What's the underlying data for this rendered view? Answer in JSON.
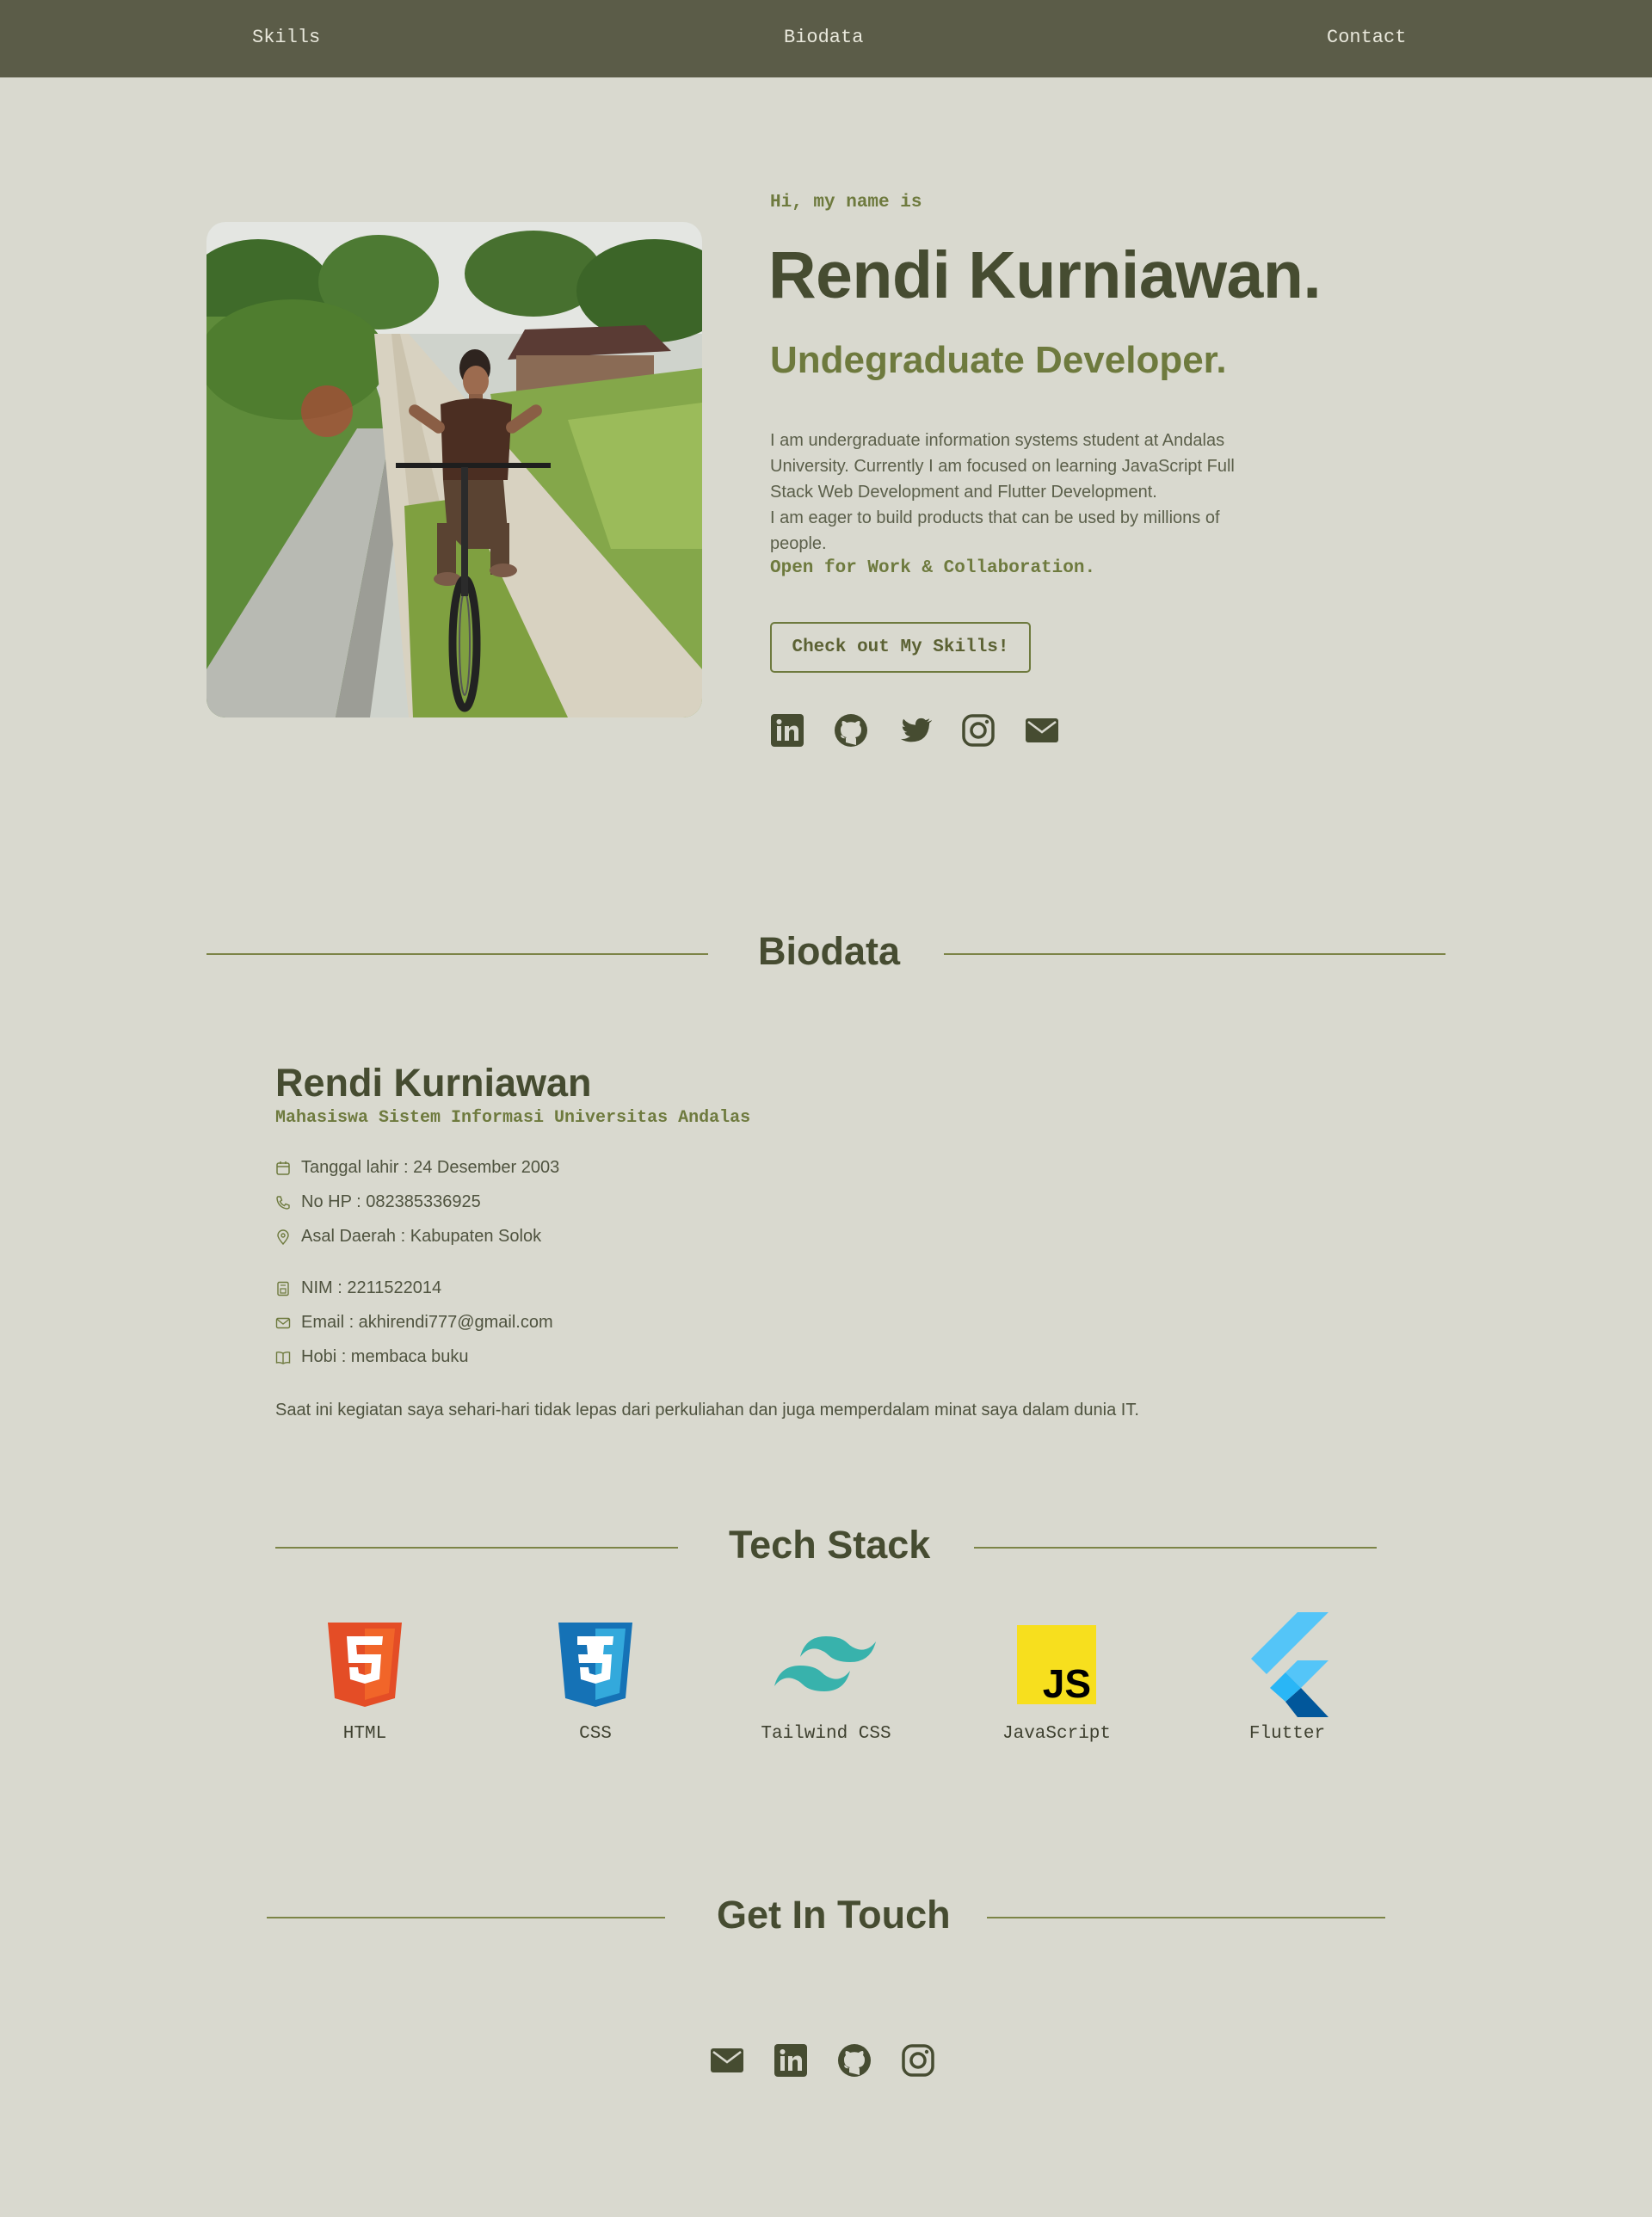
{
  "nav": {
    "items": [
      "Skills",
      "Biodata",
      "Contact"
    ]
  },
  "hero": {
    "greeting": "Hi, my name is",
    "name": "Rendi Kurniawan.",
    "role": "Undegraduate Developer.",
    "description": "I am undergraduate information systems student at Andalas University. Currently I am focused on learning JavaScript Full Stack Web Development and Flutter Development.",
    "description2": "I am eager to build products that can be used by millions of people.",
    "open_text": "Open for Work & Collaboration.",
    "cta_label": "Check out My Skills!",
    "socials": [
      "linkedin-icon",
      "github-icon",
      "twitter-icon",
      "instagram-icon",
      "mail-icon"
    ]
  },
  "biodata": {
    "heading": "Biodata",
    "name": "Rendi Kurniawan",
    "subtitle": "Mahasiswa Sistem Informasi Universitas Andalas",
    "items": [
      {
        "icon": "calendar-icon",
        "text": "Tanggal lahir : 24 Desember 2003"
      },
      {
        "icon": "phone-icon",
        "text": "No HP : 082385336925"
      },
      {
        "icon": "location-pin-icon",
        "text": "Asal Daerah : Kabupaten Solok"
      },
      {
        "icon": "id-card-icon",
        "text": "NIM : 2211522014"
      },
      {
        "icon": "envelope-icon",
        "text": "Email : akhirendi777@gmail.com"
      },
      {
        "icon": "book-icon",
        "text": "Hobi : membaca buku"
      }
    ],
    "paragraph": "Saat ini kegiatan saya sehari-hari tidak lepas dari perkuliahan dan juga memperdalam minat saya dalam dunia IT."
  },
  "tech_stack": {
    "heading": "Tech Stack",
    "items": [
      {
        "icon": "html5-logo-icon",
        "label": "HTML"
      },
      {
        "icon": "css3-logo-icon",
        "label": "CSS"
      },
      {
        "icon": "tailwind-logo-icon",
        "label": "Tailwind CSS"
      },
      {
        "icon": "javascript-logo-icon",
        "label": "JavaScript"
      },
      {
        "icon": "flutter-logo-icon",
        "label": "Flutter"
      }
    ]
  },
  "contact": {
    "heading": "Get In Touch",
    "icons": [
      "mail-icon",
      "linkedin-icon",
      "github-icon",
      "instagram-icon"
    ]
  },
  "colors": {
    "background": "#D9D9CF",
    "nav": "#5B5C48",
    "dark_olive": "#464C31",
    "accent_olive": "#6E7A3E"
  }
}
